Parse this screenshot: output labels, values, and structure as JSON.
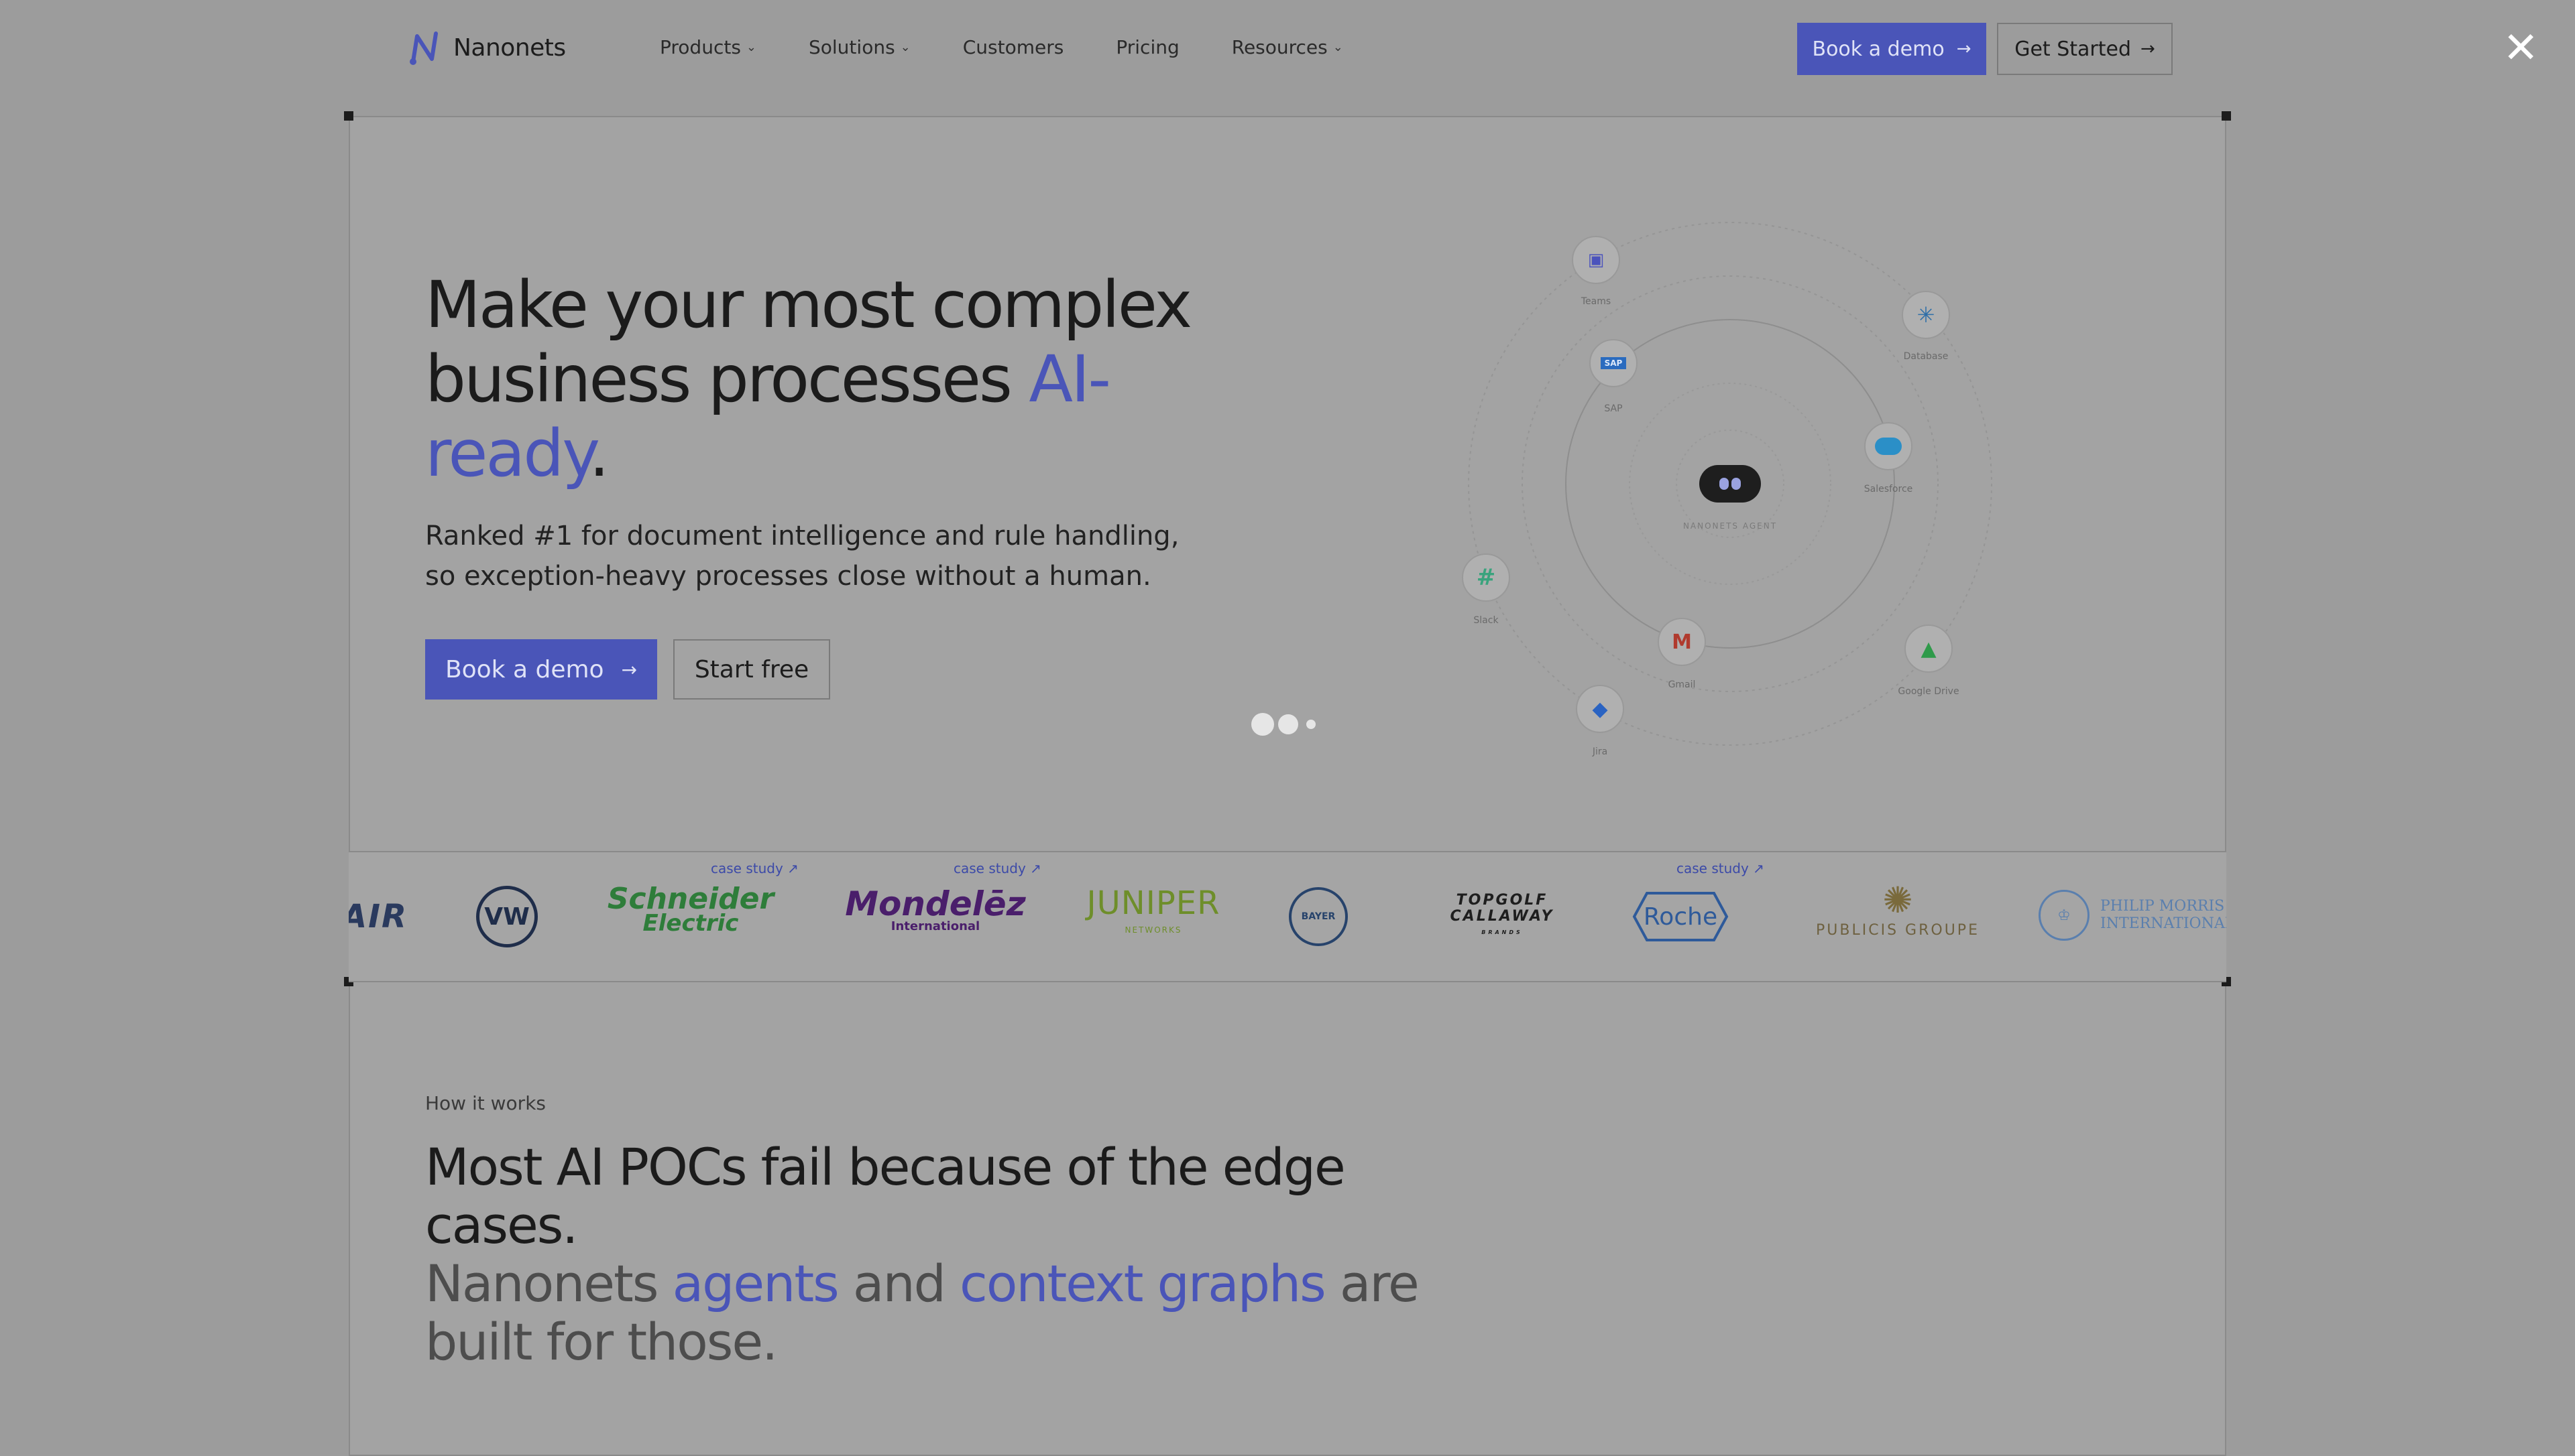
{
  "nav": {
    "brand": "Nanonets",
    "links": [
      {
        "label": "Products",
        "has_menu": true
      },
      {
        "label": "Solutions",
        "has_menu": true
      },
      {
        "label": "Customers",
        "has_menu": false
      },
      {
        "label": "Pricing",
        "has_menu": false
      },
      {
        "label": "Resources",
        "has_menu": true
      }
    ],
    "book_demo": "Book a demo",
    "get_started": "Get Started",
    "arrow": "→",
    "chevron": "⌄"
  },
  "modal": {
    "close_icon": "✕"
  },
  "hero": {
    "title_part1": "Make your most complex business processes ",
    "title_accent": "AI-ready",
    "title_end": ".",
    "subtitle": "Ranked #1 for document intelligence and rule handling, so exception-heavy processes close without a human.",
    "book_demo": "Book a demo",
    "start_free": "Start free"
  },
  "diagram": {
    "center_label": "NANONETS AGENT",
    "nodes": [
      {
        "name": "Teams"
      },
      {
        "name": "Database"
      },
      {
        "name": "SAP"
      },
      {
        "name": "Salesforce"
      },
      {
        "name": "Slack"
      },
      {
        "name": "Gmail"
      },
      {
        "name": "Google Drive"
      },
      {
        "name": "Jira"
      }
    ]
  },
  "logos": {
    "case_study": "case study ↗",
    "items": [
      "AIR",
      "VW",
      "Schneider",
      "Electric",
      "Mondelēz",
      "International",
      "JUNIPER",
      "NETWORKS",
      "BAYER",
      "TOPGOLF",
      "CALLAWAY",
      "BRANDS",
      "Roche",
      "PUBLICIS GROUPE",
      "PHILIP MORRIS",
      "INTERNATIONAL"
    ]
  },
  "how": {
    "label": "How it works",
    "line1": "Most AI POCs fail because of the edge cases.",
    "line2_a": "Nanonets ",
    "line2_b": "agents",
    "line2_c": " and ",
    "line2_d": "context graphs",
    "line2_e": " are built for those."
  },
  "colors": {
    "accent": "#4a55b8",
    "overlay": "#9c9c9c"
  }
}
